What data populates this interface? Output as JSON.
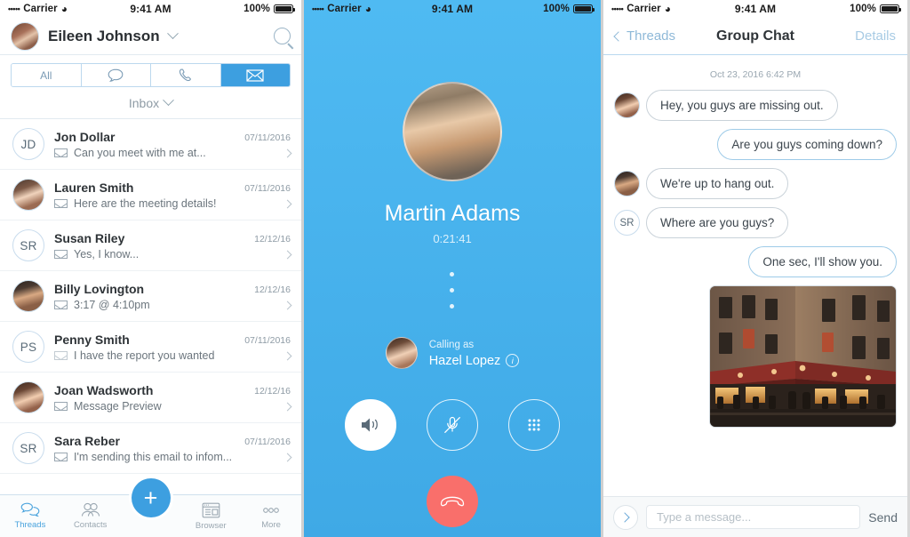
{
  "status_bar": {
    "carrier": "Carrier",
    "dots": "•••••",
    "time": "9:41 AM",
    "battery": "100%",
    "wifi_icon": "wifi-icon"
  },
  "threads_screen": {
    "header": {
      "user_name": "Eileen Johnson",
      "avatar": "eileen-avatar",
      "dropdown_icon": "chevron-down-icon",
      "search_icon": "search-icon"
    },
    "filters": [
      {
        "label": "All",
        "name": "filter-all",
        "active": false
      },
      {
        "label": "",
        "name": "filter-messages",
        "icon": "chat-bubble-icon",
        "active": false
      },
      {
        "label": "",
        "name": "filter-calls",
        "icon": "phone-icon",
        "active": false
      },
      {
        "label": "",
        "name": "filter-email",
        "icon": "envelope-icon",
        "active": true
      }
    ],
    "folder": {
      "label": "Inbox",
      "icon": "chevron-down-icon"
    },
    "threads": [
      {
        "initials": "JD",
        "avatar": "",
        "name": "Jon Dollar",
        "preview": "Can you meet with me at...",
        "date": "07/11/2016",
        "icon": "envelope-icon",
        "read": false
      },
      {
        "initials": "",
        "avatar": "lauren-avatar",
        "name": "Lauren Smith",
        "preview": "Here are the meeting details!",
        "date": "07/11/2016",
        "icon": "envelope-icon",
        "read": false
      },
      {
        "initials": "SR",
        "avatar": "",
        "name": "Susan Riley",
        "preview": "Yes, I know...",
        "date": "12/12/16",
        "icon": "envelope-icon",
        "read": false
      },
      {
        "initials": "",
        "avatar": "billy-avatar",
        "name": "Billy Lovington",
        "preview": "3:17 @ 4:10pm",
        "date": "12/12/16",
        "icon": "envelope-icon",
        "read": false
      },
      {
        "initials": "PS",
        "avatar": "",
        "name": "Penny Smith",
        "preview": "I have the report you wanted",
        "date": "07/11/2016",
        "icon": "envelope-icon",
        "read": true
      },
      {
        "initials": "",
        "avatar": "joan-avatar",
        "name": "Joan Wadsworth",
        "preview": "Message Preview",
        "date": "12/12/16",
        "icon": "envelope-icon",
        "read": false
      },
      {
        "initials": "SR",
        "avatar": "",
        "name": "Sara Reber",
        "preview": "I'm sending this email to infom...",
        "date": "07/11/2016",
        "icon": "envelope-icon",
        "read": false
      }
    ],
    "tab_bar": {
      "compose_label": "+",
      "tabs": [
        {
          "label": "Threads",
          "icon": "chat-bubbles-icon",
          "active": true
        },
        {
          "label": "Contacts",
          "icon": "contacts-icon",
          "active": false
        },
        {
          "label": "Browser",
          "icon": "browser-icon",
          "active": false
        },
        {
          "label": "More",
          "icon": "ellipsis-icon",
          "active": false
        }
      ]
    }
  },
  "call_screen": {
    "contact_name": "Martin Adams",
    "contact_avatar": "martin-avatar",
    "duration": "0:21:41",
    "calling_as_label": "Calling as",
    "calling_as_name": "Hazel Lopez",
    "calling_as_avatar": "hazel-avatar",
    "info_icon": "info-icon",
    "controls": [
      {
        "name": "speaker-button",
        "icon": "speaker-icon",
        "active": true
      },
      {
        "name": "mute-button",
        "icon": "mic-muted-icon",
        "active": false
      },
      {
        "name": "keypad-button",
        "icon": "keypad-icon",
        "active": false
      }
    ],
    "end_call": {
      "name": "end-call-button",
      "icon": "phone-hangup-icon",
      "color": "#f96f6b"
    },
    "background_color": "#4fbaf2"
  },
  "chat_screen": {
    "header": {
      "back_label": "Threads",
      "back_icon": "chevron-left-icon",
      "title": "Group Chat",
      "details_label": "Details"
    },
    "timestamp": "Oct 23, 2016 6:42 PM",
    "messages": [
      {
        "side": "in",
        "text": "Hey, you guys are missing out.",
        "avatar": "joan-avatar",
        "initials": ""
      },
      {
        "side": "out",
        "text": "Are you guys coming down?",
        "avatar": "",
        "initials": ""
      },
      {
        "side": "in",
        "text": "We're up to hang out.",
        "avatar": "billy-avatar",
        "initials": ""
      },
      {
        "side": "in",
        "text": "Where are you guys?",
        "avatar": "",
        "initials": "SR"
      },
      {
        "side": "out",
        "text": "One sec, I'll show you.",
        "avatar": "",
        "initials": ""
      }
    ],
    "attachment": {
      "name": "photo-attachment",
      "description": "street corner cafe at dusk"
    },
    "composer": {
      "expand_icon": "chevron-right-icon",
      "placeholder": "Type a message...",
      "value": "",
      "send_label": "Send"
    }
  },
  "colors": {
    "accent": "#3d9fe0",
    "call_bg": "#4fbaf2",
    "end_call": "#f96f6b",
    "text": "#2f3438",
    "muted": "#9aa7b1"
  }
}
